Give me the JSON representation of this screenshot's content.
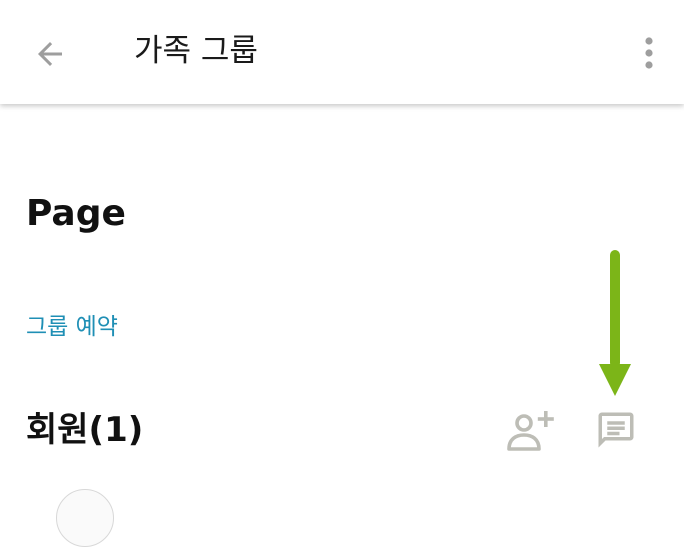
{
  "appbar": {
    "title": "가족 그룹",
    "back_icon": "arrow-left-icon",
    "menu_icon": "more-vertical-icon"
  },
  "page": {
    "title": "Page"
  },
  "group": {
    "reserve_label": "그룹 예약"
  },
  "members": {
    "title": "회원(1)",
    "add_icon": "person-add-icon",
    "message_icon": "chat-message-icon"
  },
  "annotation": {
    "type": "arrow-down",
    "color": "#7cb518"
  },
  "colors": {
    "link": "#1f8fb5",
    "icon_muted": "#9e9e9e",
    "icon_light": "#bdbdb6"
  }
}
